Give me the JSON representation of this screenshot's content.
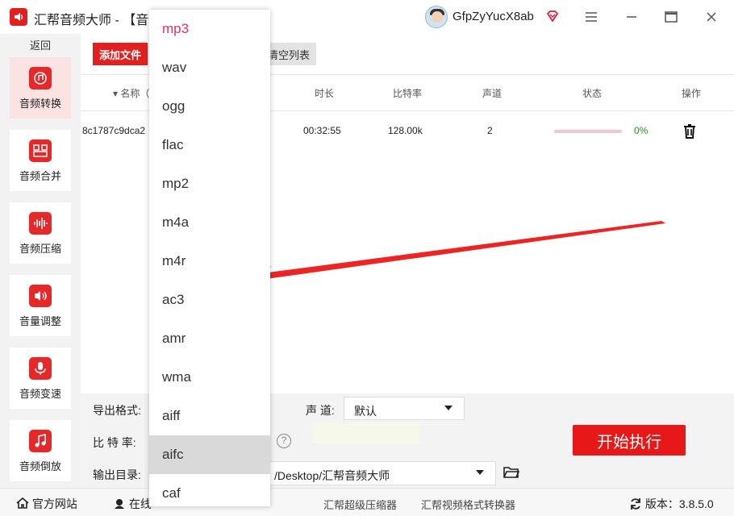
{
  "titlebar": {
    "app_title": "汇帮音频大师 - 【音",
    "username": "GfpZyYucX8ab"
  },
  "sidebar": {
    "back_label": "返回",
    "items": [
      {
        "label": "音频转换",
        "active": true
      },
      {
        "label": "音频合并"
      },
      {
        "label": "音频压缩"
      },
      {
        "label": "音量调整"
      },
      {
        "label": "音频变速"
      },
      {
        "label": "音频倒放"
      }
    ]
  },
  "toolbar": {
    "add_label": "添加文件",
    "clear_label": "清空列表"
  },
  "table": {
    "headers": {
      "name": "名称（",
      "duration": "时长",
      "bitrate": "比特率",
      "channel": "声道",
      "status": "状态",
      "action": "操作"
    },
    "row": {
      "name": "8c1787c9dca2",
      "duration": "00:32:55",
      "bitrate": "128.00k",
      "channel": "2",
      "progress": 0,
      "progress_label": "0%"
    }
  },
  "settings": {
    "format_label": "导出格式:",
    "bitrate_label": "比 特 率:",
    "output_label": "输出目录:",
    "output_path": "/Desktop/汇帮音频大师",
    "channel_label": "声 道:",
    "channel_value": "默认",
    "help": "?",
    "start_label": "开始执行"
  },
  "dropdown": {
    "options": [
      "mp3",
      "wav",
      "ogg",
      "flac",
      "mp2",
      "m4a",
      "m4r",
      "ac3",
      "amr",
      "wma",
      "aiff",
      "aifc",
      "caf"
    ],
    "selected": "mp3",
    "hovered": "aifc"
  },
  "footer": {
    "website": "官方网站",
    "online": "在线",
    "link1": "汇帮超级压缩器",
    "link2": "汇帮视频格式转换器",
    "version": "版本：3.8.5.0"
  },
  "colors": {
    "accent": "#e32020",
    "selected_option": "#e0306a",
    "progress_text": "#1a9a1a"
  }
}
